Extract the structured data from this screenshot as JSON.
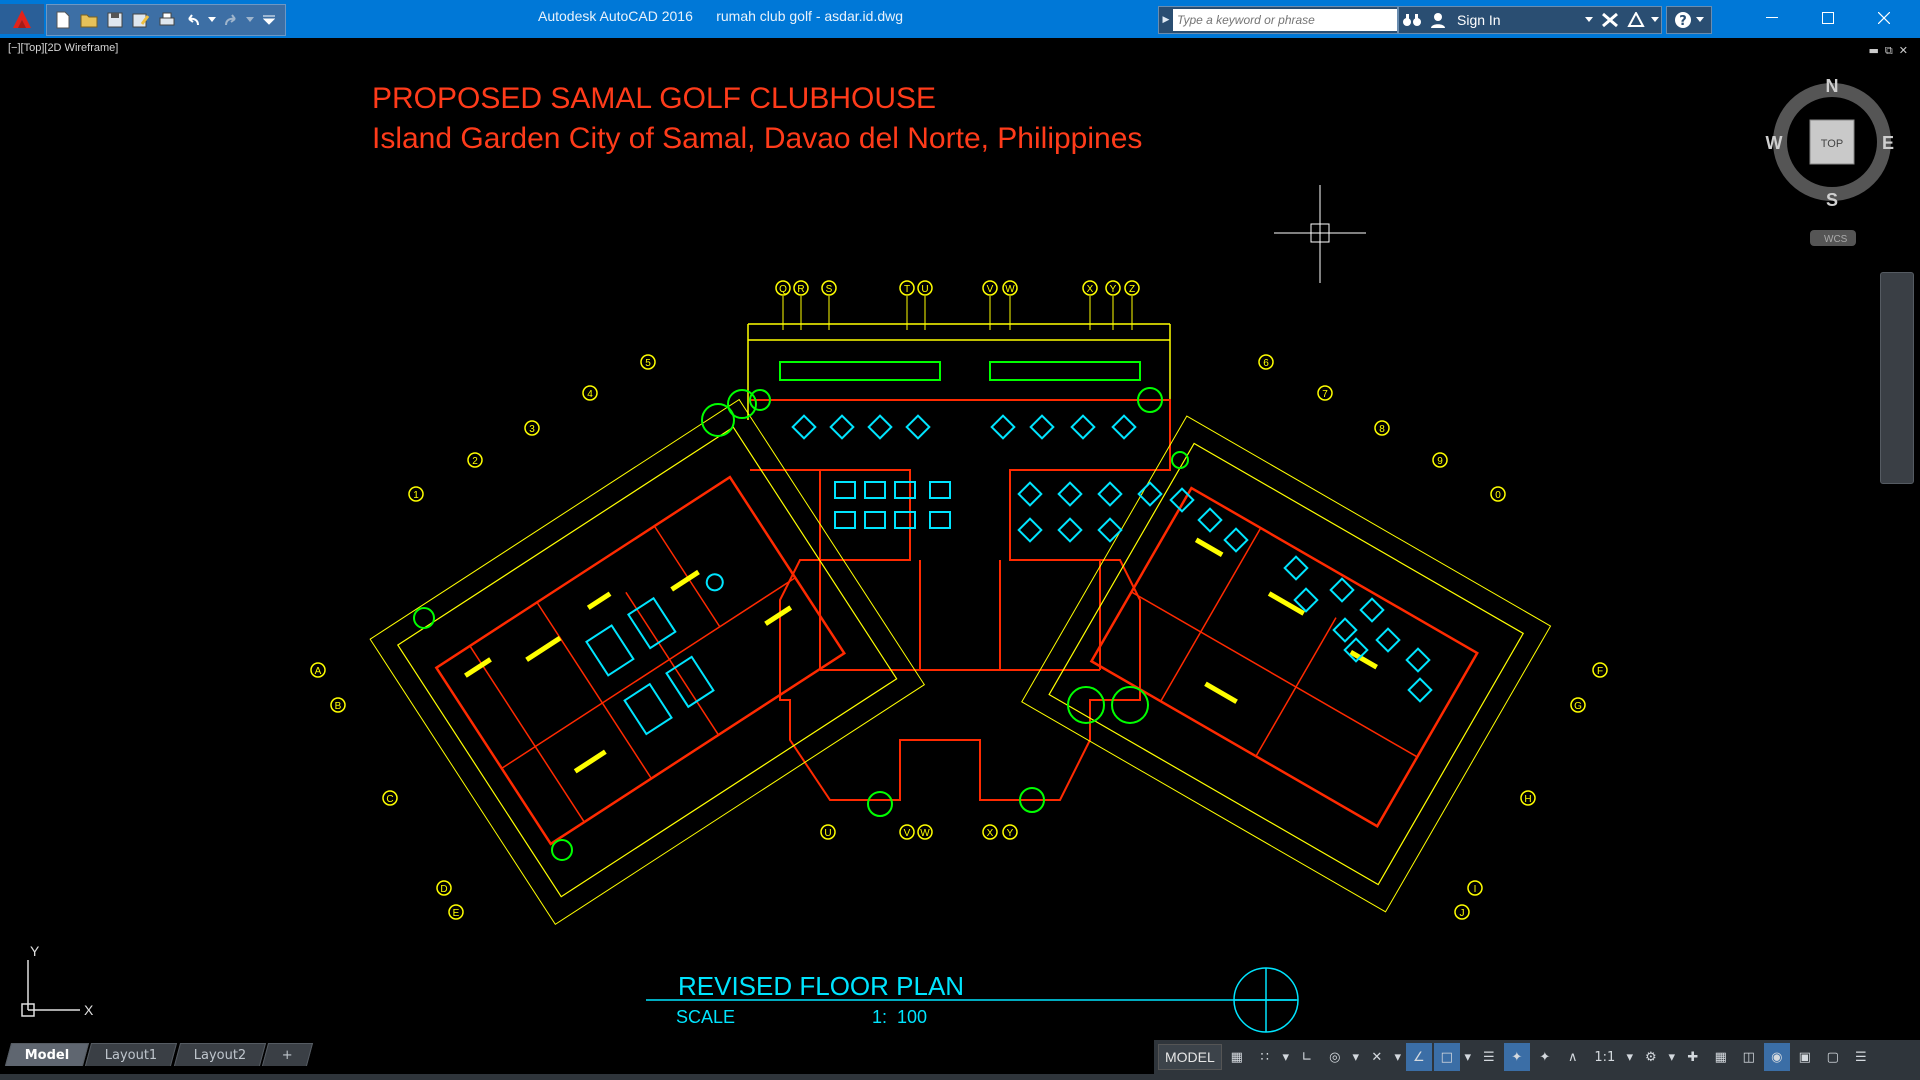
{
  "window": {
    "app_title": "Autodesk AutoCAD 2016",
    "file_title": "rumah club golf - asdar.id.dwg"
  },
  "search": {
    "placeholder": "Type a keyword or phrase"
  },
  "account": {
    "sign_in_label": "Sign In"
  },
  "viewport": {
    "label": "[−][Top][2D Wireframe]"
  },
  "viewcube": {
    "north": "N",
    "south": "S",
    "east": "E",
    "west": "W",
    "face": "TOP",
    "ucs": "WCS"
  },
  "drawing": {
    "title_line1": "PROPOSED SAMAL GOLF CLUBHOUSE",
    "title_line2": "Island Garden City of Samal, Davao del Norte, Philippines",
    "plan_title": "REVISED FLOOR PLAN",
    "scale_label": "SCALE",
    "scale_value": "1:  100",
    "grid_top": [
      "Q",
      "R",
      "S",
      "T",
      "U",
      "V",
      "W",
      "X",
      "Y",
      "Z"
    ],
    "grid_bottom": [
      "U",
      "V",
      "W",
      "X",
      "Y"
    ],
    "grid_left_arc": [
      "A",
      "B",
      "C",
      "D",
      "E"
    ],
    "grid_right_arc": [
      "F",
      "G",
      "H",
      "I",
      "J"
    ],
    "grid_left_radial": [
      "1",
      "2",
      "3",
      "4",
      "5"
    ],
    "grid_right_radial": [
      "6",
      "7",
      "8",
      "9",
      "0"
    ],
    "ucs_y": "Y",
    "ucs_x": "X"
  },
  "layout_tabs": [
    "Model",
    "Layout1",
    "Layout2",
    "+"
  ],
  "status": {
    "model_label": "MODEL",
    "scale": "1:1"
  },
  "colors": {
    "titlebar": "#0078d7",
    "title_text": "#ff3b1a",
    "plan_text": "#00e5ff",
    "yellow": "#ffff00",
    "red": "#ff2a00",
    "cyan": "#00e5ff",
    "green": "#00ff00"
  }
}
